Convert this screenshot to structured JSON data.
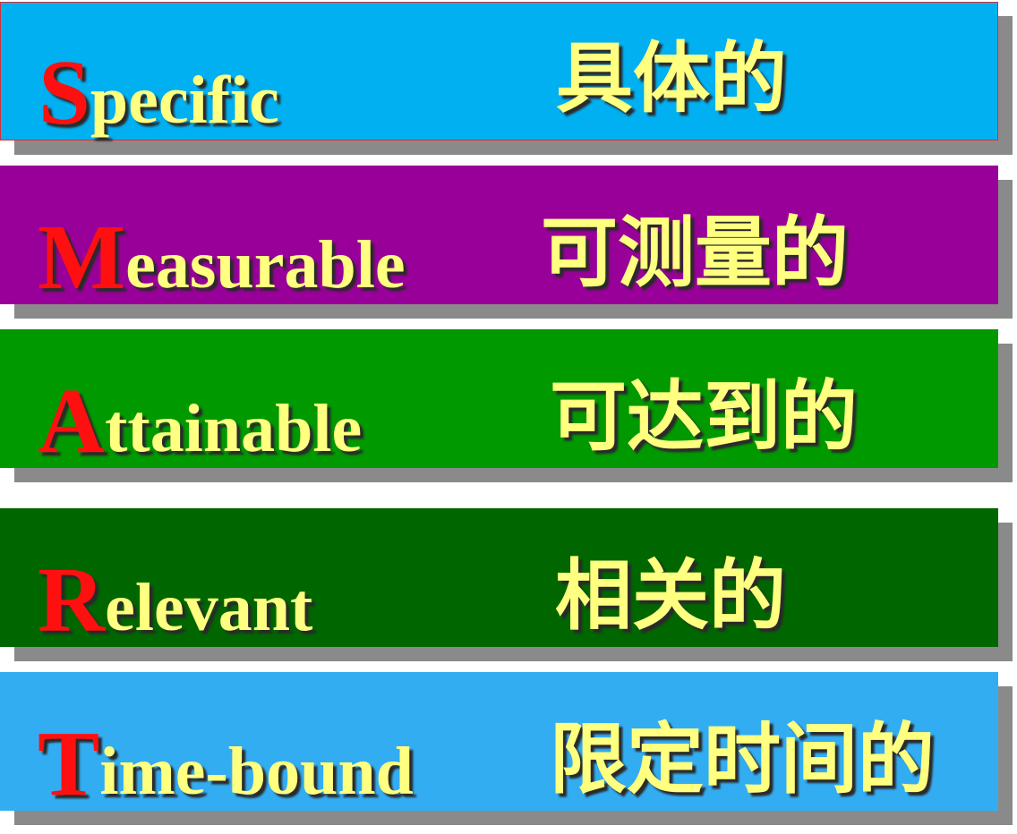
{
  "items": [
    {
      "initial": "S",
      "rest": " pecific",
      "chinese": "具体的",
      "color": "#00b0f0"
    },
    {
      "initial": "M",
      "rest": "easurable",
      "chinese": "可测量的",
      "color": "#990099"
    },
    {
      "initial": "A",
      "rest": " ttainable",
      "chinese": "可达到的",
      "color": "#009900"
    },
    {
      "initial": "R",
      "rest": " elevant",
      "chinese": "相关的",
      "color": "#006600"
    },
    {
      "initial": "T",
      "rest": " ime-bound",
      "chinese": "限定时间的",
      "color": "#33adf2"
    }
  ]
}
